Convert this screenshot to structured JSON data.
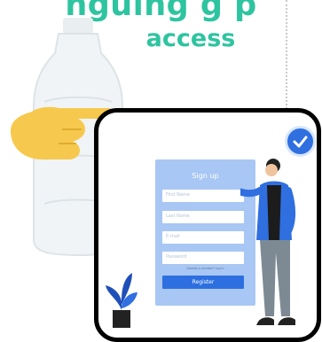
{
  "header": {
    "partial_text": "nguing  g  p",
    "access": "access"
  },
  "form": {
    "title": "Sign up",
    "fields": [
      "First Name",
      "Last Name",
      "E-mail",
      "Password"
    ],
    "have_account": "Already a member? Log In",
    "register": "Register"
  },
  "icons": {
    "hand": "pointing-hand-icon",
    "check": "check-badge-icon",
    "bottle": "water-bottle",
    "plant": "potted-plant"
  },
  "colors": {
    "accent": "#2ec4a0",
    "primary": "#2d6fe0",
    "card": "#a9c7f4"
  }
}
